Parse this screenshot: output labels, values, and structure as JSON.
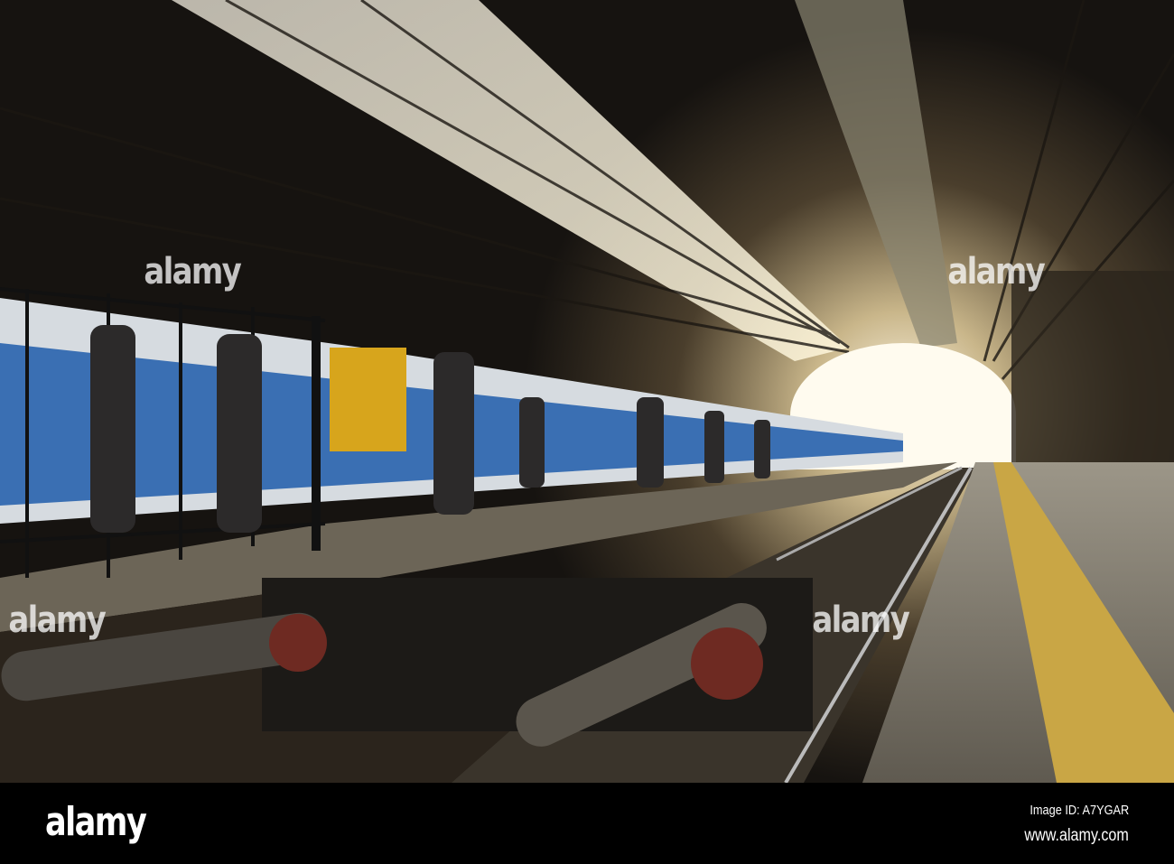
{
  "photo": {
    "subject": "train-station-platform"
  },
  "watermark": {
    "text": "alamy"
  },
  "footer": {
    "logo": "alamy",
    "image_id": "Image ID: A7YGAR",
    "website": "www.alamy.com"
  }
}
